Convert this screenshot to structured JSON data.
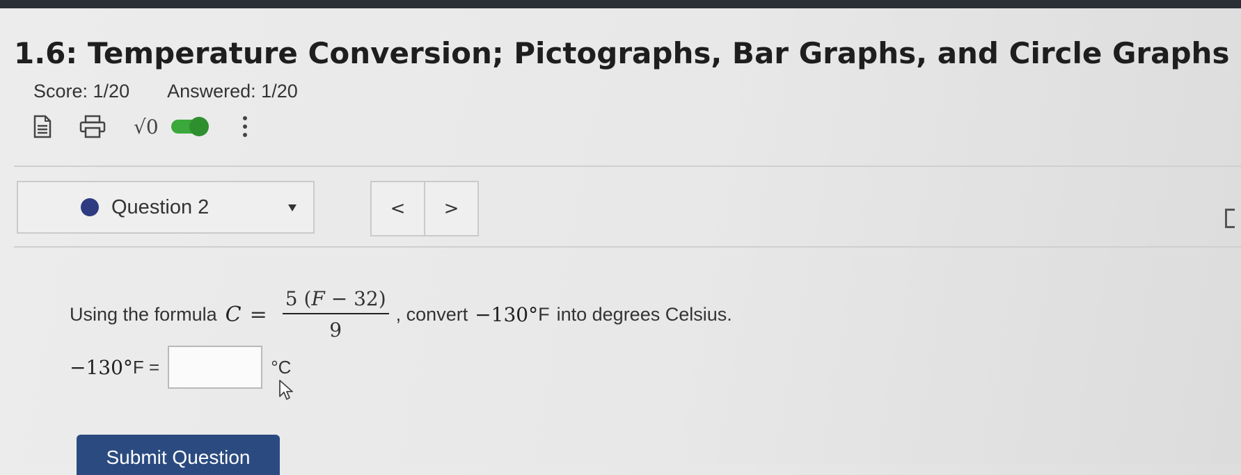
{
  "header": {
    "title": "1.6: Temperature Conversion; Pictographs, Bar Graphs, and Circle Graphs",
    "score": "Score: 1/20",
    "answered": "Answered: 1/20"
  },
  "toolbar": {
    "icons": [
      "document-icon",
      "print-icon",
      "sqrt-icon",
      "toggle-switch",
      "more-vertical-icon"
    ],
    "sqrt_label": "√0",
    "toggle_color": "#3aa83a"
  },
  "question_nav": {
    "label": "Question 2",
    "prev": "<",
    "next": ">",
    "dot_color": "#2f3b80"
  },
  "question": {
    "intro": "Using the formula",
    "formula_lhs": "C",
    "equals": "=",
    "num_coeff": "5",
    "num_open": "(",
    "num_var": "F",
    "num_rest": " − 32)",
    "denominator": "9",
    "after_formula": ", convert",
    "value": "−130°",
    "value_unit": "F",
    "tail": "into degrees Celsius."
  },
  "answer": {
    "lhs_value": "−130°",
    "lhs_unit": "F =",
    "input_value": "",
    "rhs_unit": "°C"
  },
  "submit": {
    "label": "Submit Question",
    "color": "#2b4b80"
  }
}
